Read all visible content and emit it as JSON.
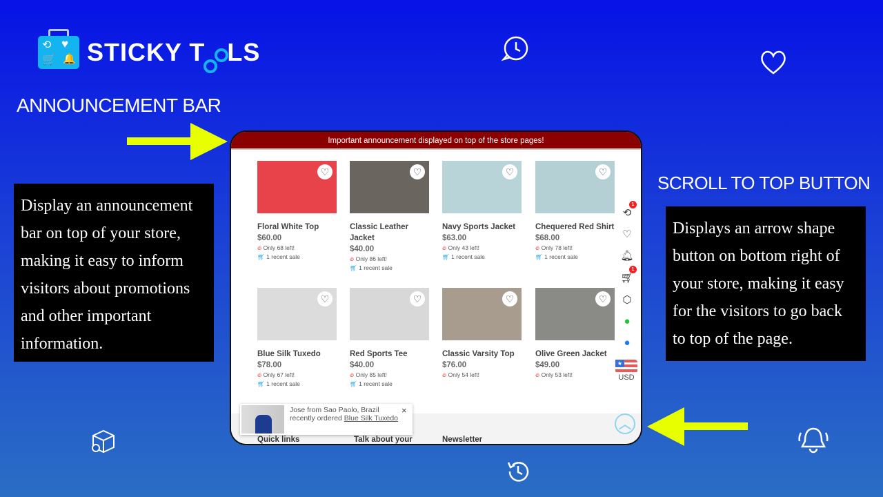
{
  "brand": {
    "name_part1": "STICKY T",
    "name_part2": "LS"
  },
  "left": {
    "heading": "ANNOUNCEMENT BAR",
    "description": "Display an announcement bar on top of your store, making it easy to inform  visitors about promotions and other important information."
  },
  "right": {
    "heading": "SCROLL TO TOP BUTTON",
    "description": "Displays an arrow shape button on bottom right of your store, making it easy for the visitors to go back to top of the page."
  },
  "colors": {
    "announcement_bg": "#8b0000",
    "arrow": "#e8ff00",
    "background_top": "#0712e6",
    "background_bottom": "#2a6ec4"
  },
  "store": {
    "announcement": "Important announcement displayed on top of the store pages!",
    "products": [
      {
        "name": "Floral White Top",
        "price": "$60.00",
        "stock": "Only 68 left!",
        "sale": "1 recent sale",
        "color": "#e8434a"
      },
      {
        "name": "Classic Leather Jacket",
        "price": "$40.00",
        "stock": "Only 86 left!",
        "sale": "1 recent sale",
        "color": "#6b6560"
      },
      {
        "name": "Navy Sports Jacket",
        "price": "$63.00",
        "stock": "Only 43 left!",
        "sale": "1 recent sale",
        "color": "#b9d4d8"
      },
      {
        "name": "Chequered Red Shirt",
        "price": "$68.00",
        "stock": "Only 78 left!",
        "sale": "1 recent sale",
        "color": "#b5d0d4"
      },
      {
        "name": "Blue Silk Tuxedo",
        "price": "$78.00",
        "stock": "Only 67 left!",
        "sale": "1 recent sale",
        "color": "#dcdcdc"
      },
      {
        "name": "Red Sports Tee",
        "price": "$40.00",
        "stock": "Only 85 left!",
        "sale": "1 recent sale",
        "color": "#d8d8d8"
      },
      {
        "name": "Classic Varsity Top",
        "price": "$76.00",
        "stock": "Only 54 left!",
        "sale": "",
        "color": "#a89c8e"
      },
      {
        "name": "Olive Green Jacket",
        "price": "$49.00",
        "stock": "Only 53 left!",
        "sale": "",
        "color": "#8a8a86"
      }
    ],
    "sidebar": {
      "history_badge": "1",
      "cart_badge": "1",
      "currency": "USD"
    },
    "popup": {
      "text": "Jose from Sao Paolo, Brazil recently ordered ",
      "product": "Blue Silk Tuxedo",
      "close": "×"
    },
    "footer": {
      "col1": "Quick links",
      "col2": "Talk about your",
      "col3": "Newsletter"
    }
  }
}
